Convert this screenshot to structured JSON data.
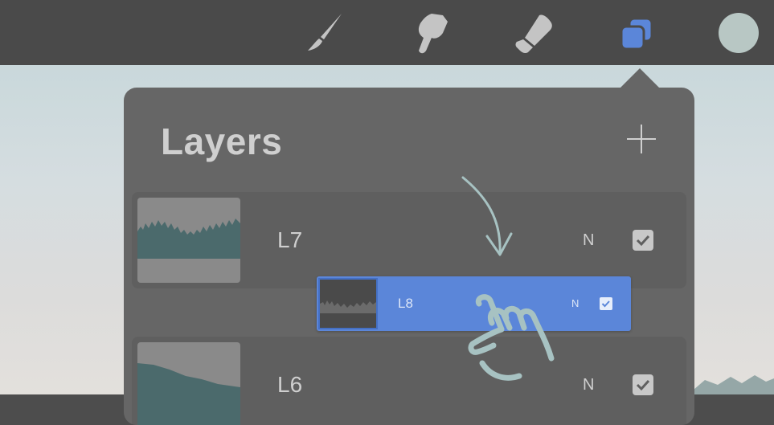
{
  "toolbar": {
    "tools": [
      {
        "icon": "brush-icon"
      },
      {
        "icon": "smudge-icon"
      },
      {
        "icon": "eraser-icon"
      },
      {
        "icon": "layers-icon",
        "active": true
      },
      {
        "icon": "color-swatch-icon"
      }
    ],
    "accent_color": "#5b86d9",
    "swatch_color": "#b8c7c4"
  },
  "layers_panel": {
    "title": "Layers",
    "add_icon": "plus-icon",
    "layers": [
      {
        "name": "L7",
        "blend_mode": "N",
        "visible": true
      },
      {
        "name": "L6",
        "blend_mode": "N",
        "visible": true
      }
    ],
    "dragging_layer": {
      "name": "L8",
      "blend_mode": "N",
      "visible": true
    }
  },
  "gesture": {
    "arrow_icon": "curved-down-arrow-icon",
    "hand_icon": "pointing-hand-icon"
  }
}
